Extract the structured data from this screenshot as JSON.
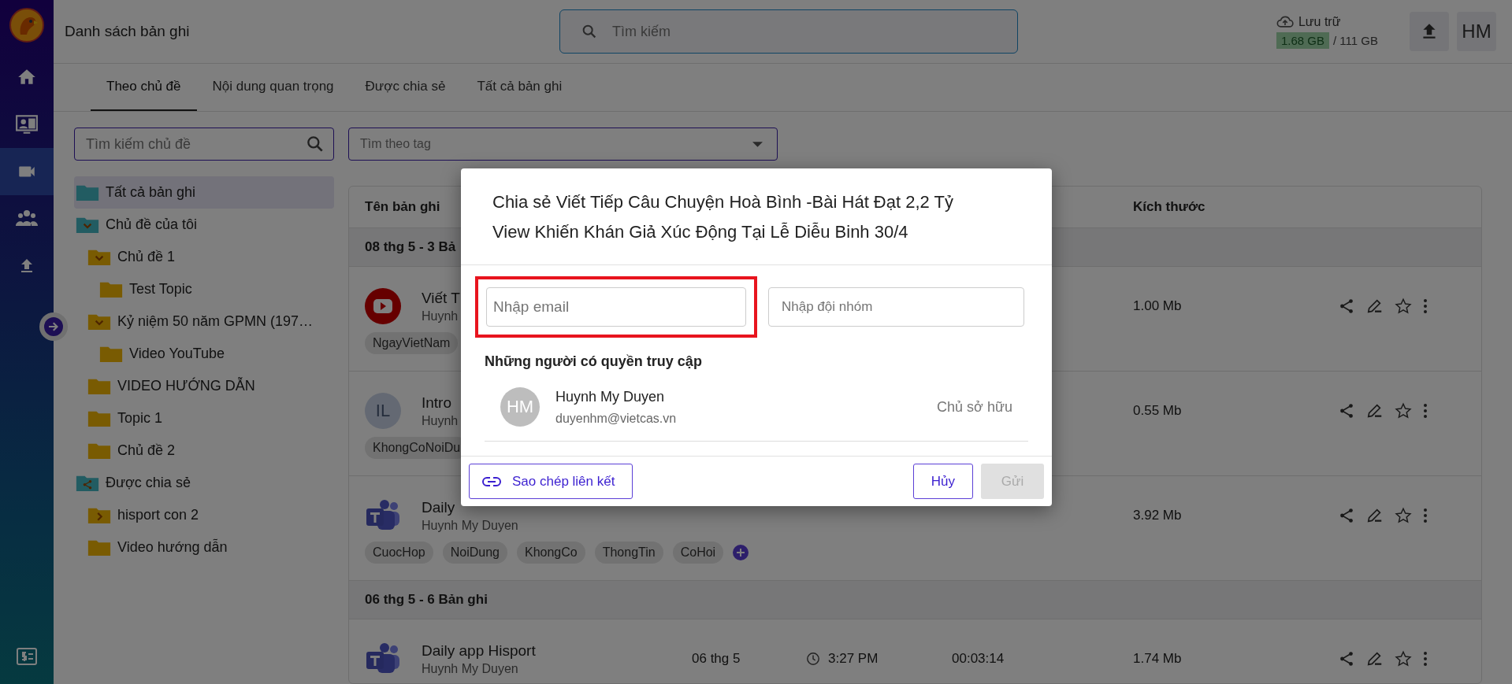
{
  "nav": {
    "items": [
      {
        "selected": false
      },
      {
        "selected": false
      },
      {
        "selected": true
      },
      {
        "selected": false
      },
      {
        "selected": false
      }
    ]
  },
  "header": {
    "title": "Danh sách bản ghi",
    "search": {
      "placeholder": "Tìm kiếm"
    },
    "storage": {
      "label": "Lưu trữ",
      "used": "1.68 GB",
      "total": "/ 111 GB"
    },
    "avatar": "HM"
  },
  "tabs": [
    {
      "label": "Theo chủ đề",
      "selected": true
    },
    {
      "label": "Nội dung quan trọng",
      "selected": false
    },
    {
      "label": "Được chia sẻ",
      "selected": false
    },
    {
      "label": "Tất cả bản ghi",
      "selected": false
    }
  ],
  "topic_search": {
    "placeholder": "Tìm kiếm chủ đề"
  },
  "tag_filter": {
    "placeholder": "Tìm theo tag"
  },
  "tree": [
    {
      "label": "Tất cả bản ghi",
      "kind": "root",
      "selected": true
    },
    {
      "label": "Chủ đề của tôi",
      "kind": "root",
      "selected": false,
      "expanded": true,
      "children": [
        {
          "label": "Chủ đề 1",
          "kind": "folder",
          "selected": false,
          "expanded": true,
          "children": [
            {
              "label": "Test Topic",
              "kind": "folder",
              "selected": false
            }
          ]
        },
        {
          "label": "Kỷ niệm 50 năm GPMN (197…",
          "kind": "folder",
          "selected": false,
          "expanded": true,
          "children": [
            {
              "label": "Video YouTube",
              "kind": "folder",
              "selected": false
            }
          ]
        },
        {
          "label": "VIDEO HƯỚNG DẪN",
          "kind": "folder",
          "selected": false
        },
        {
          "label": "Topic 1",
          "kind": "folder",
          "selected": false
        },
        {
          "label": "Chủ đề 2",
          "kind": "folder",
          "selected": false
        }
      ]
    },
    {
      "label": "Được chia sẻ",
      "kind": "shared",
      "selected": false,
      "children": [
        {
          "label": "hisport con 2",
          "kind": "folder",
          "selected": false,
          "expanded": false
        },
        {
          "label": "Video hướng dẫn",
          "kind": "folder",
          "selected": false
        }
      ]
    }
  ],
  "table": {
    "columns": [
      {
        "label": "Tên bản ghi"
      },
      {
        "label": "Kích thước"
      }
    ],
    "groups": [
      {
        "label": "08 thg 5 - 3 Bả",
        "rows": [
          {
            "kind": "youtube",
            "title": "Viết T",
            "owner": "Huynh",
            "size": "1.00 Mb",
            "starred": false,
            "tags": [
              "NgayVietNam"
            ],
            "add_tag": false
          },
          {
            "kind": "initials",
            "initials": "IL",
            "title": "Intro",
            "owner": "Huynh",
            "size": "0.55 Mb",
            "starred": false,
            "tags": [
              "KhongCoNoiDu"
            ],
            "add_tag": false
          },
          {
            "kind": "teams",
            "title": "Daily",
            "owner": "Huynh My Duyen",
            "size": "3.92 Mb",
            "starred": false,
            "tags": [
              "CuocHop",
              "NoiDung",
              "KhongCo",
              "ThongTin",
              "CoHoi"
            ],
            "add_tag": true
          }
        ]
      },
      {
        "label": "06 thg 5 - 6 Bản ghi",
        "rows": [
          {
            "kind": "teams",
            "title": "Daily app Hisport",
            "owner": "Huynh My Duyen",
            "date": "06 thg 5",
            "time": "3:27 PM",
            "duration": "00:03:14",
            "size": "1.74 Mb",
            "starred": false,
            "add_tag": false
          }
        ]
      }
    ]
  },
  "dialog": {
    "title": "Chia sẻ Viết Tiếp Câu Chuyện Hoà Bình -Bài Hát Đạt 2,2 Tỷ View Khiến Khán Giả Xúc Động Tại Lễ Diễu Binh 30/4",
    "email": {
      "placeholder": "Nhập email",
      "highlighted": true
    },
    "team": {
      "placeholder": "Nhập đội nhóm"
    },
    "access_heading": "Những người có quyền truy cập",
    "people": [
      {
        "initials": "HM",
        "name": "Huynh My Duyen",
        "email": "duyenhm@vietcas.vn",
        "role": "Chủ sở hữu"
      }
    ],
    "copy_link": "Sao chép liên kết",
    "cancel": "Hủy",
    "send": {
      "label": "Gửi",
      "disabled": true
    }
  }
}
